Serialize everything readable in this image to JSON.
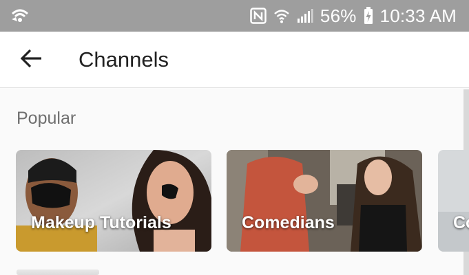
{
  "status_bar": {
    "battery": "56%",
    "time": "10:33 AM",
    "icons": [
      "wifi-calling-icon",
      "nfc-icon",
      "wifi-icon",
      "signal-icon",
      "battery-charging-icon"
    ]
  },
  "app_bar": {
    "back_icon": "arrow-left-icon",
    "title": "Channels"
  },
  "sections": [
    {
      "title": "Popular",
      "channels": [
        {
          "label": "Makeup Tutorials"
        },
        {
          "label": "Comedians"
        },
        {
          "label": "Co"
        }
      ]
    }
  ],
  "colors": {
    "status_bar": "#9e9e9e",
    "title_text": "#212121",
    "section_text": "#6f6f6f",
    "background": "#fafafa"
  }
}
